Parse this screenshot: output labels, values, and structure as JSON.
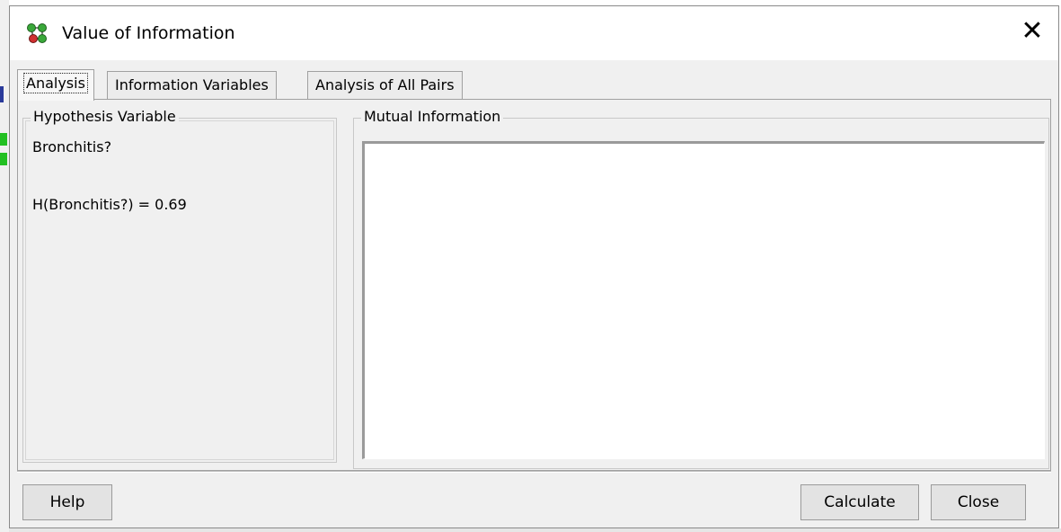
{
  "window": {
    "title": "Value of Information",
    "icon": "network-nodes-icon",
    "close_glyph": "✕"
  },
  "tabs": [
    {
      "label": "Analysis",
      "active": true
    },
    {
      "label": "Information Variables",
      "active": false
    },
    {
      "label": "Analysis of All Pairs",
      "active": false
    }
  ],
  "hypothesis": {
    "legend": "Hypothesis Variable",
    "variable": "Bronchitis?",
    "entropy": "H(Bronchitis?) = 0.69"
  },
  "mutual_information": {
    "legend": "Mutual Information",
    "content": ""
  },
  "buttons": {
    "help": "Help",
    "calculate": "Calculate",
    "close": "Close"
  },
  "colors": {
    "bg_strip_blue": "#2a3a9a",
    "bg_strip_green": "#22c022",
    "icon_green": "#3aa83a",
    "icon_red": "#d03030"
  }
}
